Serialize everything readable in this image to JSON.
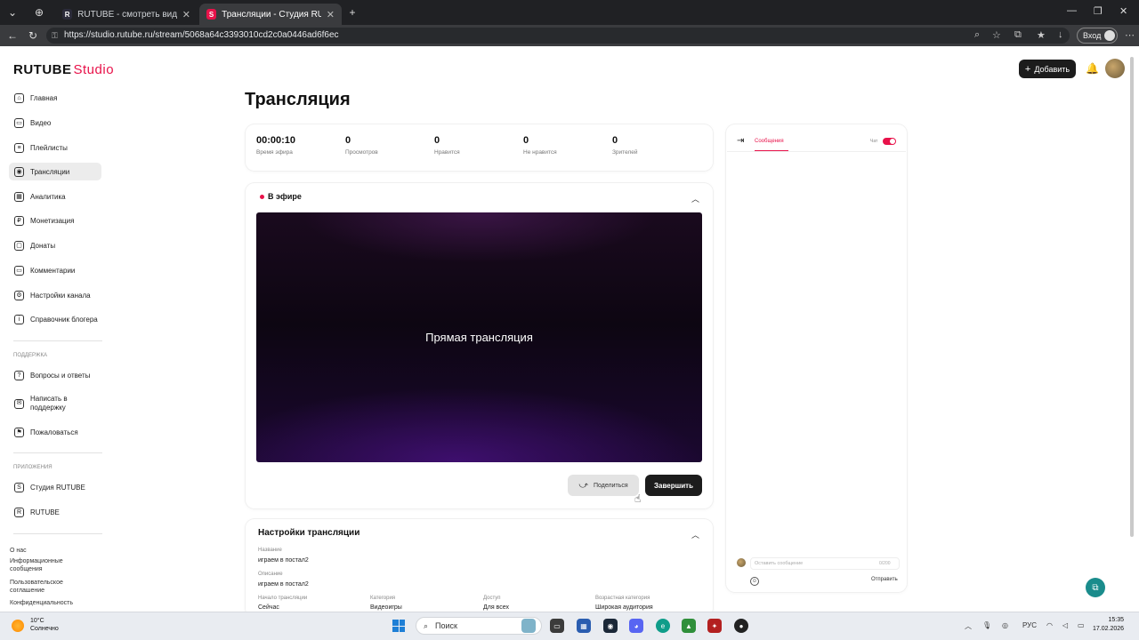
{
  "browser": {
    "tabs": [
      {
        "title": "RUTUBE - смотреть видео онлай",
        "favicon": "R"
      },
      {
        "title": "Трансляции - Студия RUTUBE",
        "favicon": "S"
      }
    ],
    "url": "https://studio.rutube.ru/stream/5068a64c3393010cd2c0a0446ad6f6ec",
    "login_label": "Вход"
  },
  "header": {
    "logo_main": "RUTUBE",
    "logo_studio": "Studio",
    "add_label": "Добавить"
  },
  "sidebar": {
    "items": [
      {
        "label": "Главная",
        "icon": "home-icon",
        "glyph": "⌂"
      },
      {
        "label": "Видео",
        "icon": "video-icon",
        "glyph": "▭"
      },
      {
        "label": "Плейлисты",
        "icon": "playlist-icon",
        "glyph": "≡"
      },
      {
        "label": "Трансляции",
        "icon": "broadcast-icon",
        "glyph": "◉"
      },
      {
        "label": "Аналитика",
        "icon": "analytics-icon",
        "glyph": "▦"
      },
      {
        "label": "Монетизация",
        "icon": "monetization-icon",
        "glyph": "₽"
      },
      {
        "label": "Донаты",
        "icon": "donate-icon",
        "glyph": "▢"
      },
      {
        "label": "Комментарии",
        "icon": "comments-icon",
        "glyph": "▭"
      },
      {
        "label": "Настройки канала",
        "icon": "settings-icon",
        "glyph": "⚙"
      },
      {
        "label": "Справочник блогера",
        "icon": "info-icon",
        "glyph": "i"
      }
    ],
    "support_title": "Поддержка",
    "support_items": [
      {
        "label": "Вопросы и ответы",
        "icon": "faq-icon",
        "glyph": "?"
      },
      {
        "label": "Написать в поддержку",
        "icon": "mail-icon",
        "glyph": "✉"
      },
      {
        "label": "Пожаловаться",
        "icon": "flag-icon",
        "glyph": "⚑"
      }
    ],
    "apps_title": "Приложения",
    "app_items": [
      {
        "label": "Студия RUTUBE",
        "icon": "studio-app-icon",
        "glyph": "S"
      },
      {
        "label": "RUTUBE",
        "icon": "rutube-app-icon",
        "glyph": "R"
      }
    ],
    "footer_links": [
      "О нас",
      "Информационные сообщения",
      "Пользовательское соглашение",
      "Конфиденциальность"
    ]
  },
  "main": {
    "title": "Трансляция",
    "stats": [
      {
        "value": "00:00:10",
        "label": "Время эфира"
      },
      {
        "value": "0",
        "label": "Просмотров"
      },
      {
        "value": "0",
        "label": "Нравится"
      },
      {
        "value": "0",
        "label": "Не нравится"
      },
      {
        "value": "0",
        "label": "Зрителей"
      }
    ],
    "live_label": "В эфире",
    "player_text": "Прямая трансляция",
    "share_label": "Поделиться",
    "end_label": "Завершить",
    "settings": {
      "title": "Настройки трансляции",
      "name_label": "Название",
      "name_value": "играем в постал2",
      "desc_label": "Описание",
      "desc_value": "играем в постал2",
      "start_label": "Начало трансляции",
      "start_value": "Сейчас",
      "category_label": "Категория",
      "category_value": "Видеоигры",
      "access_label": "Доступ",
      "access_value": "Для всех",
      "age_label": "Возрастная категория",
      "age_value": "Широкая аудитория"
    }
  },
  "chat": {
    "tab_label": "Сообщения",
    "toggle_label": "Чат",
    "input_placeholder": "Оставить сообщение",
    "counter": "0/200",
    "send_label": "Отправить"
  },
  "taskbar": {
    "temperature": "10°C",
    "weather": "Солнечно",
    "search_label": "Поиск",
    "lang": "РУС",
    "time": "15:35",
    "date": "17.02.2026"
  },
  "colors": {
    "accent": "#e8124a",
    "dark_button": "#1c1c1c",
    "player_purple": "#3e0f6e"
  }
}
